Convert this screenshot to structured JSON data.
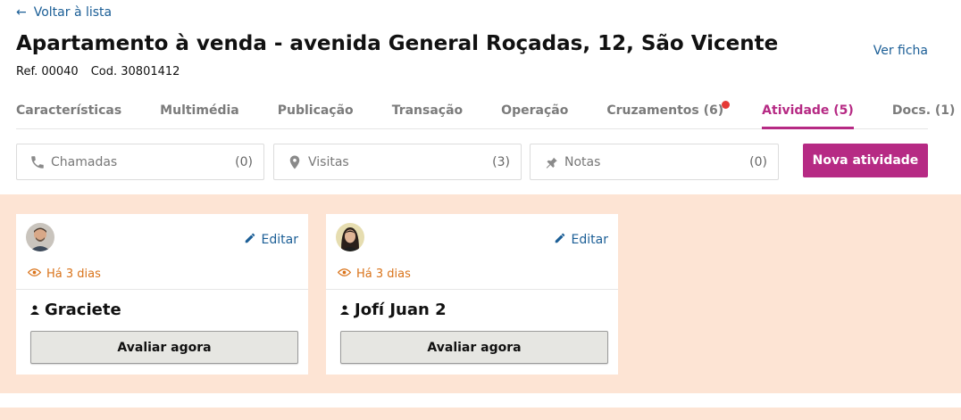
{
  "back": {
    "label": "Voltar à lista"
  },
  "header": {
    "title": "Apartamento à venda - avenida General Roçadas, 12, São Vicente",
    "ref": "Ref. 00040",
    "cod": "Cod. 30801412",
    "ver_ficha": "Ver ficha"
  },
  "tabs": [
    {
      "label": "Características"
    },
    {
      "label": "Multimédia"
    },
    {
      "label": "Publicação"
    },
    {
      "label": "Transação"
    },
    {
      "label": "Operação"
    },
    {
      "label": "Cruzamentos (6)",
      "notification_dot": true
    },
    {
      "label": "Atividade (5)",
      "active": true
    },
    {
      "label": "Docs. (1)"
    }
  ],
  "filters": [
    {
      "label": "Chamadas",
      "count": "(0)",
      "icon": "phone-icon"
    },
    {
      "label": "Visitas",
      "count": "(3)",
      "icon": "location-pin-icon"
    },
    {
      "label": "Notas",
      "count": "(0)",
      "icon": "pushpin-icon"
    }
  ],
  "nova_atividade": "Nova atividade",
  "cards": [
    {
      "edit": "Editar",
      "ago": "Há 3 dias",
      "person": "Graciete",
      "action": "Avaliar agora",
      "avatar": "male-avatar"
    },
    {
      "edit": "Editar",
      "ago": "Há 3 dias",
      "person": "Jofí Juan 2",
      "action": "Avaliar agora",
      "avatar": "female-avatar"
    }
  ],
  "colors": {
    "accent": "#b62a84",
    "link": "#1b5e96",
    "band": "#fde4d4",
    "time": "#d9731a",
    "notification": "#e53935"
  }
}
